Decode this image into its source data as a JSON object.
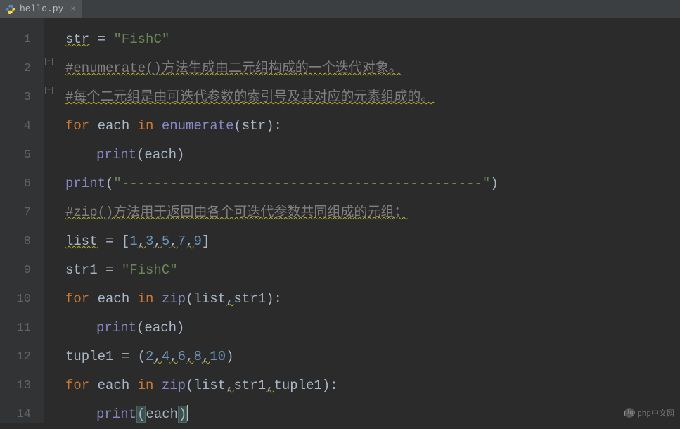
{
  "tab": {
    "filename": "hello.py",
    "close": "×"
  },
  "gutter": {
    "lines": [
      "1",
      "2",
      "3",
      "4",
      "5",
      "6",
      "7",
      "8",
      "9",
      "10",
      "11",
      "12",
      "13",
      "14"
    ]
  },
  "code": {
    "l1": {
      "var": "str",
      "op": " = ",
      "str": "\"FishC\""
    },
    "l2": {
      "comment": "#enumerate()方法生成由二元组构成的一个迭代对象。"
    },
    "l3": {
      "comment": "#每个二元组是由可迭代参数的索引号及其对应的元素组成的。"
    },
    "l4": {
      "for": "for",
      "each": " each ",
      "in": "in",
      "fn": " enumerate",
      "p1": "(",
      "arg": "str",
      "p2": "):"
    },
    "l5": {
      "fn": "print",
      "p1": "(",
      "arg": "each",
      "p2": ")"
    },
    "l6": {
      "fn": "print",
      "p1": "(",
      "str": "\"---------------------------------------------\"",
      "p2": ")"
    },
    "l7": {
      "comment": "#zip()方法用于返回由各个可迭代参数共同组成的元组；"
    },
    "l8": {
      "var": "list",
      "op": " = [",
      "n1": "1",
      "c": ",",
      "n2": "3",
      "n3": "5",
      "n4": "7",
      "n5": "9",
      "close": "]"
    },
    "l9": {
      "var": "str1 = ",
      "str": "\"FishC\""
    },
    "l10": {
      "for": "for",
      "each": " each ",
      "in": "in",
      "fn": " zip",
      "p1": "(",
      "a1": "list",
      "c": ",",
      "a2": "str1",
      "p2": "):"
    },
    "l11": {
      "fn": "print",
      "p1": "(",
      "arg": "each",
      "p2": ")"
    },
    "l12": {
      "var": "tuple1 = (",
      "n1": "2",
      "c": ",",
      "n2": "4",
      "n3": "6",
      "n4": "8",
      "n5": "10",
      "close": ")"
    },
    "l13": {
      "for": "for",
      "each": " each ",
      "in": "in",
      "fn": " zip",
      "p1": "(",
      "a1": "list",
      "c": ",",
      "a2": "str1",
      "a3": "tuple1",
      "p2": "):"
    },
    "l14": {
      "fn": "print",
      "p1": "(",
      "arg": "each",
      "p2": ")"
    }
  },
  "watermark": {
    "text": "php中文网"
  }
}
